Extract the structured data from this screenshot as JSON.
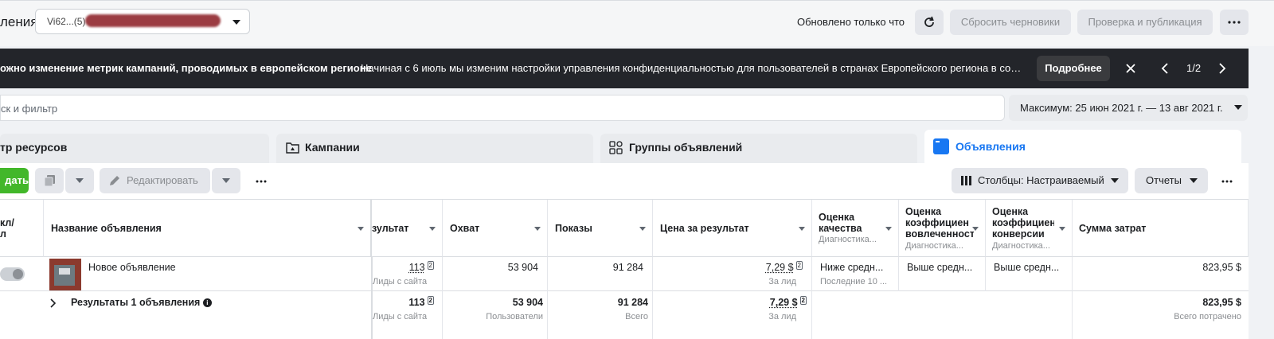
{
  "header": {
    "title": "ления",
    "account_value": "Vi62...(5)",
    "updated": "Обновлено только что",
    "reset_label": "Сбросить черновики",
    "publish_label": "Проверка и публикация"
  },
  "banner": {
    "title": "ожно изменение метрик кампаний, проводимых в европейском регионе",
    "text": "Начиная с 6 июль мы изменим настройки управления конфиденциальностью для пользователей в странах Европейского региона в соо…",
    "more_label": "Подробнее",
    "page": "1/2"
  },
  "search": {
    "placeholder": "ск и фильтр"
  },
  "date_range": "Максимум: 25 июн 2021 г. — 13 авг 2021 г.",
  "tabs": [
    {
      "label": "тр ресурсов",
      "icon": "filter-icon"
    },
    {
      "label": "Кампании",
      "icon": "folder-icon"
    },
    {
      "label": "Группы объявлений",
      "icon": "grid-icon"
    },
    {
      "label": "Объявления",
      "icon": "ad-icon",
      "active": true
    }
  ],
  "toolbar": {
    "create_label": "дать",
    "edit_label": "Редактировать",
    "columns_label": "Столбцы: Настраиваемый",
    "reports_label": "Отчеты"
  },
  "table": {
    "columns": {
      "toggle": "кл/\nл",
      "name": "Название объявления",
      "result": "зультат",
      "reach": "Охват",
      "impressions": "Показы",
      "cost": "Цена за результат",
      "quality": "Оценка качества",
      "quality_sub": "Диагностика...",
      "engagement": "Оценка коэффициен вовлеченност",
      "engagement_sub": "Диагностика...",
      "conversion": "Оценка коэффициен конверсии",
      "conversion_sub": "Диагностика...",
      "spend": "Сумма затрат"
    },
    "rows": [
      {
        "name": "Новое объявление",
        "toggle_on": false,
        "result": "113",
        "result_sub": "Лиды с сайта",
        "reach": "53 904",
        "impressions": "91 284",
        "cost": "7,29 $",
        "cost_sub": "За лид",
        "quality": "Ниже средн...",
        "quality_sub": "Последние 10 ...",
        "engagement": "Выше средн...",
        "conversion": "Выше средн...",
        "spend": "823,95 $"
      }
    ],
    "summary": {
      "label": "Результаты 1 объявления",
      "result": "113",
      "result_sub": "Лиды с сайта",
      "reach": "53 904",
      "reach_sub": "Пользователи",
      "impressions": "91 284",
      "impressions_sub": "Всего",
      "cost": "7,29 $",
      "cost_sub": "За лид",
      "spend": "823,95 $",
      "spend_sub": "Всего потрачено"
    }
  },
  "colors": {
    "accent": "#1877f2",
    "create": "#42b72a",
    "banner": "#23252a"
  }
}
